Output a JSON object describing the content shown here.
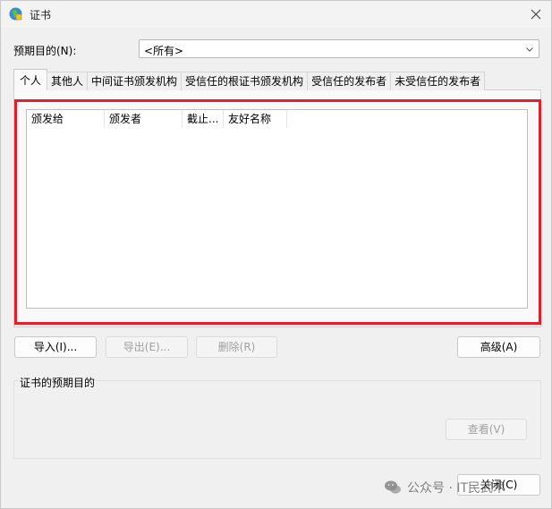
{
  "window": {
    "title": "证书"
  },
  "purpose": {
    "label": "预期目的(N):",
    "selected": "<所有>"
  },
  "tabs": [
    {
      "label": "个人",
      "active": true
    },
    {
      "label": "其他人",
      "active": false
    },
    {
      "label": "中间证书颁发机构",
      "active": false
    },
    {
      "label": "受信任的根证书颁发机构",
      "active": false
    },
    {
      "label": "受信任的发布者",
      "active": false
    },
    {
      "label": "未受信任的发布者",
      "active": false
    }
  ],
  "list": {
    "columns": [
      "颁发给",
      "颁发者",
      "截止...",
      "友好名称"
    ],
    "rows": []
  },
  "buttons": {
    "import": "导入(I)...",
    "export": "导出(E)...",
    "remove": "删除(R)",
    "advanced": "高级(A)",
    "view": "查看(V)",
    "close": "关闭(C)"
  },
  "group": {
    "title": "证书的预期目的"
  },
  "watermark": {
    "text": "公众号 · IT民武术"
  },
  "colors": {
    "highlight": "#e0202a",
    "window_bg": "#f0f0f0"
  }
}
